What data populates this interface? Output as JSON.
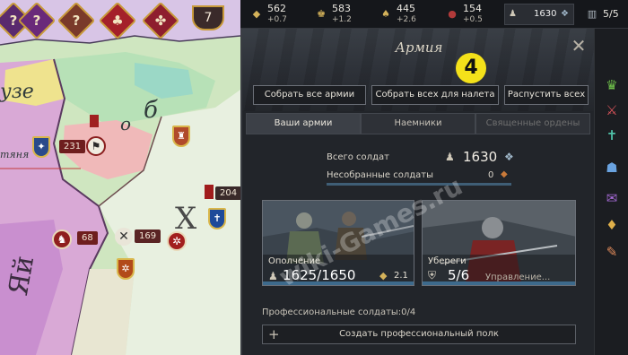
{
  "map": {
    "region_label_left": "узе",
    "region_label_mid": "б",
    "region_label_o": "о",
    "region_label_x": "Х",
    "region_label_tyanya": "тяня",
    "region_label_vertical": "Яй",
    "top_icons": [
      {
        "name": "question-event-1",
        "glyph": "?",
        "color": "#5a2a6e"
      },
      {
        "name": "question-event-2",
        "glyph": "?",
        "color": "#6a2a7a"
      },
      {
        "name": "question-event-3",
        "glyph": "?",
        "color": "#7a3a2a"
      },
      {
        "name": "faith-event",
        "glyph": "♣",
        "color": "#a4202a"
      },
      {
        "name": "war-event",
        "glyph": "✤",
        "color": "#8e1e2e"
      }
    ],
    "top_counter": "7",
    "armies": [
      {
        "count": "231"
      },
      {
        "count": "68"
      },
      {
        "count": "169"
      },
      {
        "count": "204"
      }
    ]
  },
  "resources": {
    "gold": {
      "value": "562",
      "delta": "+0.7",
      "icon": "gold-icon"
    },
    "prestige": {
      "value": "583",
      "delta": "+1.2",
      "icon": "prestige-icon"
    },
    "piety": {
      "value": "445",
      "delta": "+2.6",
      "icon": "piety-icon"
    },
    "dread": {
      "value": "154",
      "delta": "+0.5",
      "icon": "dread-icon"
    },
    "troops": {
      "value": "1630",
      "icon": "soldier-icon"
    },
    "domain": {
      "value": "5/5",
      "icon": "domain-icon"
    }
  },
  "panel": {
    "title": "Армия",
    "close_glyph": "✕",
    "step_marker": "4",
    "buttons": {
      "gather_all": "Собрать все армии",
      "gather_raid": "Собрать всех для налета",
      "disband_all": "Распустить всех"
    },
    "tabs": {
      "my_armies": "Ваши армии",
      "mercenaries": "Наемники",
      "holy_orders": "Священные ордены"
    },
    "totals": {
      "total_label": "Всего солдат",
      "total_value": "1630",
      "ungathered_label": "Несобранные солдаты",
      "ungathered_value": "0"
    },
    "levies": {
      "label": "Ополчение",
      "value": "1625/1650",
      "upkeep": "2.1"
    },
    "guards": {
      "label": "Убереги",
      "value": "5/6",
      "manage": "Управление..."
    },
    "professional": {
      "label": "Профессиональные солдаты:",
      "value": "0/4"
    },
    "create_regiment": "Создать профессиональный полк",
    "watermark": "wiki-Games.ru"
  },
  "rail": {
    "icons": [
      {
        "name": "crown-icon",
        "glyph": "♛",
        "color": "#6fbf4a"
      },
      {
        "name": "crossed-swords-icon",
        "glyph": "⚔",
        "color": "#d9535a"
      },
      {
        "name": "faith-icon",
        "glyph": "✝",
        "color": "#4fc1a8"
      },
      {
        "name": "council-icon",
        "glyph": "☗",
        "color": "#6aa3e0"
      },
      {
        "name": "scroll-icon",
        "glyph": "✉",
        "color": "#a66ad6"
      },
      {
        "name": "schemes-icon",
        "glyph": "♦",
        "color": "#e0b04a"
      },
      {
        "name": "quill-icon",
        "glyph": "✎",
        "color": "#e08a5a"
      }
    ]
  }
}
